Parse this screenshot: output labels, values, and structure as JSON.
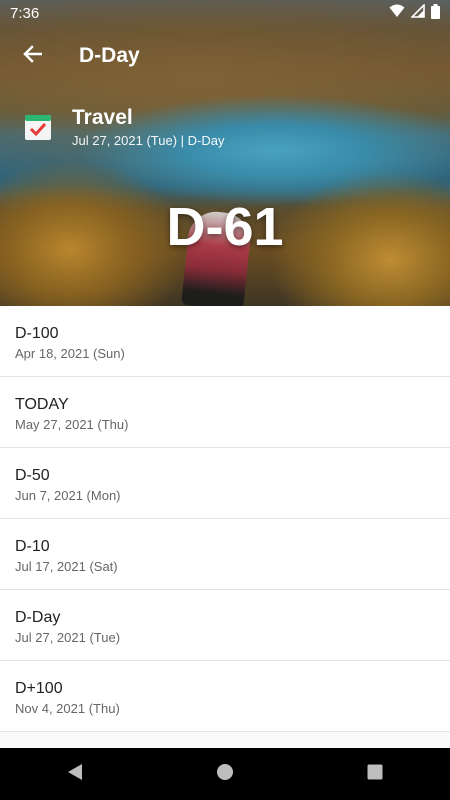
{
  "status_bar": {
    "time": "7:36"
  },
  "app_bar": {
    "title": "D-Day"
  },
  "event": {
    "title": "Travel",
    "subtitle": "Jul 27, 2021 (Tue) | D-Day",
    "countdown": "D-61"
  },
  "milestones": [
    {
      "label": "D-100",
      "date": "Apr 18, 2021 (Sun)"
    },
    {
      "label": "TODAY",
      "date": "May 27, 2021 (Thu)"
    },
    {
      "label": "D-50",
      "date": "Jun 7, 2021 (Mon)"
    },
    {
      "label": "D-10",
      "date": "Jul 17, 2021 (Sat)"
    },
    {
      "label": "D-Day",
      "date": "Jul 27, 2021 (Tue)"
    },
    {
      "label": "D+100",
      "date": "Nov 4, 2021 (Thu)"
    }
  ],
  "icons": {
    "back": "arrow-back-icon",
    "calendar": "calendar-check-icon",
    "wifi": "wifi-icon",
    "signal": "signal-icon",
    "battery": "battery-icon",
    "nav_back": "nav-back-icon",
    "nav_home": "nav-home-icon",
    "nav_recents": "nav-recents-icon"
  },
  "colors": {
    "check_red": "#e53935",
    "list_divider": "#e2e2e2",
    "nav_bar": "#000000"
  }
}
